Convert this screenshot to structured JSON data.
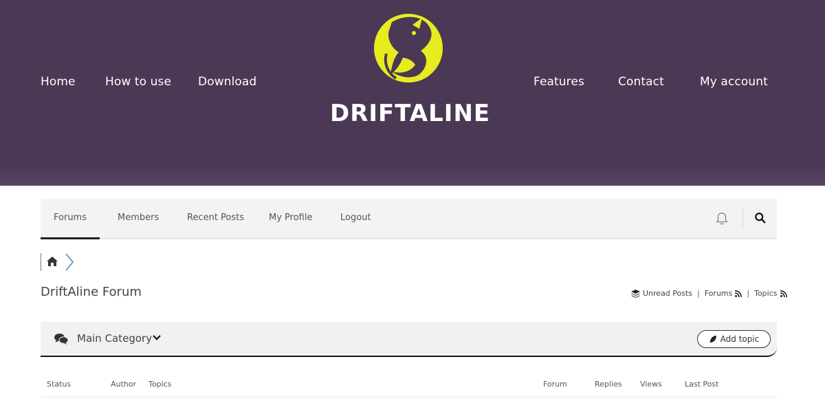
{
  "site": {
    "brand": "DRIFTALINE",
    "nav_left": [
      "Home",
      "How to use",
      "Download"
    ],
    "nav_right": [
      "Features",
      "Contact",
      "My account"
    ],
    "colors": {
      "hero_bg": "#4a3854",
      "logo_yellow": "#e8ec1e",
      "text_white": "#ffffff"
    }
  },
  "forum_nav": {
    "tabs": [
      "Forums",
      "Members",
      "Recent Posts",
      "My Profile",
      "Logout"
    ],
    "active_tab": "Forums",
    "icons": {
      "notifications": "bell-icon",
      "search": "search-icon"
    }
  },
  "breadcrumb": {
    "icons": [
      "home-icon",
      "chevron-right-icon"
    ]
  },
  "page": {
    "title": "DriftAline Forum",
    "quick_links": {
      "unread": "Unread Posts",
      "forums": "Forums",
      "topics": "Topics"
    }
  },
  "category": {
    "name": "Main Category",
    "add_topic_label": "Add topic"
  },
  "table": {
    "columns": [
      "Status",
      "Author",
      "Topics",
      "Forum",
      "Replies",
      "Views",
      "Last Post"
    ]
  }
}
